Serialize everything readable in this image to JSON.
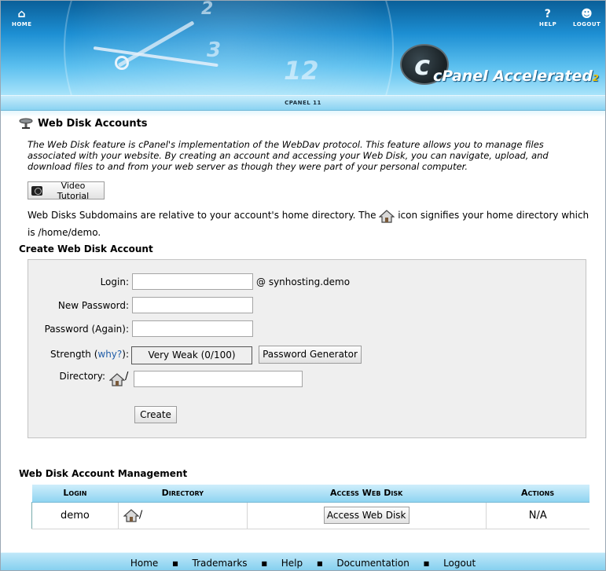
{
  "header": {
    "home_label": "HOME",
    "help_label": "HELP",
    "logout_label": "LOGOUT",
    "logo_main": "cPanel Accelerated",
    "logo_sub": "2",
    "version": "CPANEL 11"
  },
  "page": {
    "title": "Web Disk Accounts",
    "intro": "The Web Disk feature is cPanel's implementation of the WebDav protocol. This feature allows you to manage files associated with your website. By creating an account and accessing your Web Disk, you can navigate, upload, and download files to and from your web server as though they were part of your personal computer.",
    "video_button": "Video Tutorial",
    "relative_text_1": "Web Disks Subdomains are relative to your account's home directory. The",
    "relative_text_2": "icon signifies your home directory which is /home/demo."
  },
  "create_form": {
    "heading": "Create Web Disk Account",
    "login_label": "Login:",
    "login_value": "",
    "domain": "@ synhosting.demo",
    "password_label": "New Password:",
    "password_again_label": "Password (Again):",
    "strength_label": "Strength (",
    "strength_link": "why?",
    "strength_close": "):",
    "strength_value": "Very Weak (0/100)",
    "generator_button": "Password Generator",
    "directory_label": "Directory:",
    "directory_slash": "/",
    "directory_value": "",
    "create_button": "Create"
  },
  "management": {
    "heading": "Web Disk Account Management",
    "columns": [
      "Login",
      "Directory",
      "Access Web Disk",
      "Actions"
    ],
    "rows": [
      {
        "login": "demo",
        "directory": "/",
        "access_button": "Access Web Disk",
        "actions": "N/A"
      }
    ]
  },
  "footer": {
    "links": [
      "Home",
      "Trademarks",
      "Help",
      "Documentation",
      "Logout"
    ],
    "separator": "■"
  }
}
